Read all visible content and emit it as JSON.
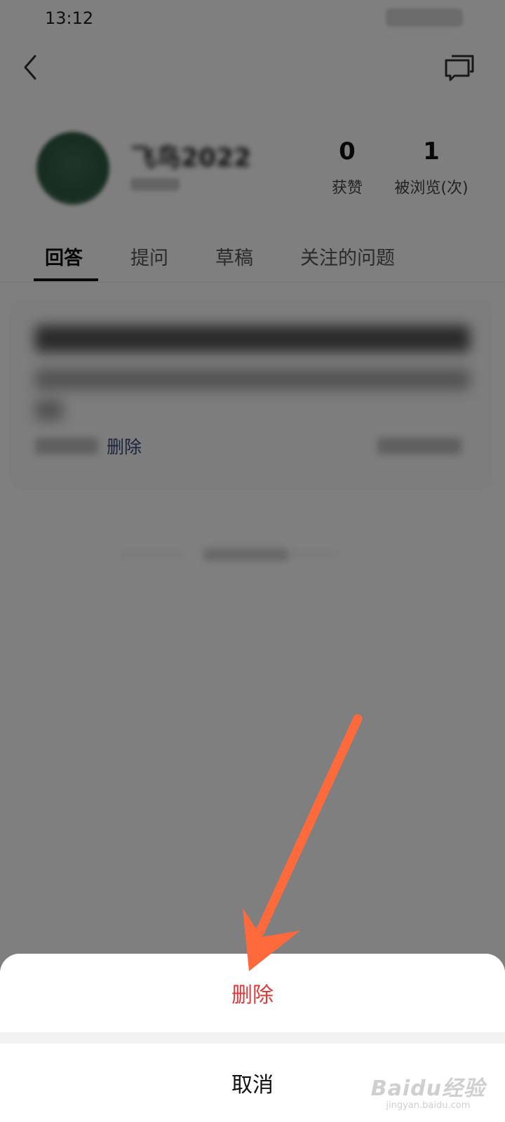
{
  "status_bar": {
    "time": "13:12"
  },
  "header": {
    "back_icon": "chevron-left-icon",
    "message_icon": "chat-bubbles-icon"
  },
  "profile": {
    "username": "飞鸟2022",
    "stats": [
      {
        "value": "0",
        "label": "获赞"
      },
      {
        "value": "1",
        "label": "被浏览(次)"
      }
    ]
  },
  "tabs": [
    {
      "label": "回答",
      "active": true
    },
    {
      "label": "提问",
      "active": false
    },
    {
      "label": "草稿",
      "active": false
    },
    {
      "label": "关注的问题",
      "active": false
    }
  ],
  "answer_card": {
    "delete_label": "删除"
  },
  "action_sheet": {
    "delete_label": "删除",
    "cancel_label": "取消"
  },
  "annotation": {
    "arrow_color": "#ff6a3d"
  },
  "colors": {
    "danger": "#e0393a",
    "link": "#3a4a7a",
    "overlay": "rgba(0,0,0,0.5)"
  },
  "watermark": {
    "logo": "Baidu经验",
    "url": "jingyan.baidu.com"
  }
}
